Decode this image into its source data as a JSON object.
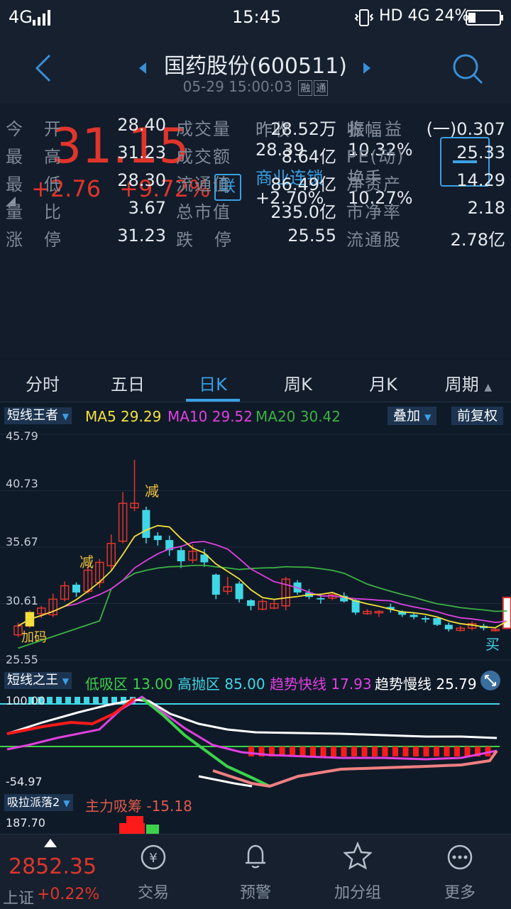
{
  "status": {
    "network": "4G",
    "time": "15:45",
    "right": "HD 4G 24%"
  },
  "header": {
    "title": "国药股份(600511)",
    "datetime": "05-29 15:00:03",
    "tag1": "融",
    "tag2": "通"
  },
  "quote": {
    "price": "31.15",
    "change": "+2.76",
    "change_pct": "+9.72%",
    "lian": "联",
    "prev_close_label": "昨收",
    "prev_close": "28.39",
    "amplitude_label": "振幅",
    "amplitude": "10.32%",
    "sector_label": "商业连锁",
    "sector_pct": "+2.70%",
    "turnover_label": "换手",
    "turnover": "10.27%"
  },
  "grid": [
    {
      "l1": "今开",
      "v1": "28.40",
      "l2": "成交量",
      "v2": "28.52万",
      "l3": "收益",
      "v3": "(一)0.307"
    },
    {
      "l1": "最高",
      "v1": "31.23",
      "l2": "成交额",
      "v2": "8.64亿",
      "l3": "PE(动)",
      "v3": "25.33"
    },
    {
      "l1": "最低",
      "v1": "28.30",
      "l2": "流通值",
      "v2": "86.49亿",
      "l3": "净资产",
      "v3": "14.29"
    },
    {
      "l1": "量比",
      "v1": "3.67",
      "l2": "总市值",
      "v2": "235.0亿",
      "l3": "市净率",
      "v3": "2.18"
    },
    {
      "l1": "涨停",
      "v1": "31.23",
      "l2": "跌停",
      "v2": "25.55",
      "l3": "流通股",
      "v3": "2.78亿"
    }
  ],
  "tabs": [
    "分时",
    "五日",
    "日K",
    "周K",
    "月K",
    "周期"
  ],
  "kline": {
    "indicator": "短线王者",
    "ma5_label": "MA5",
    "ma5": "29.29",
    "ma10_label": "MA10",
    "ma10": "29.52",
    "ma20_label": "MA20",
    "ma20": "30.42",
    "btn_overlay": "叠加",
    "btn_adjust": "前复权",
    "axis": [
      "45.79",
      "40.73",
      "35.67",
      "30.61",
      "25.55"
    ],
    "signal_reduce": "减",
    "signal_add": "加码",
    "signal_buy": "买",
    "colors": {
      "up": "#e0352b",
      "down": "#3fd7e6",
      "ma5": "#f2e13a",
      "ma10": "#e040e0",
      "ma20": "#3cb043"
    }
  },
  "osc": {
    "indicator": "短线之王",
    "low_label": "低吸区",
    "low": "13.00",
    "high_label": "高抛区",
    "high": "85.00",
    "fast_label": "趋势快线",
    "fast": "17.93",
    "slow_label": "趋势慢线",
    "slow": "25.79",
    "axis_top": "100.00",
    "axis_bottom": "-54.97"
  },
  "third": {
    "indicator": "吸拉派落2",
    "label": "主力吸筹",
    "value": "-15.18",
    "axis_top": "187.70"
  },
  "bottom_nav": {
    "index_value": "2852.35",
    "index_name": "上证",
    "index_pct": "+0.22%",
    "items": [
      "交易",
      "预警",
      "加分组",
      "更多"
    ]
  }
}
